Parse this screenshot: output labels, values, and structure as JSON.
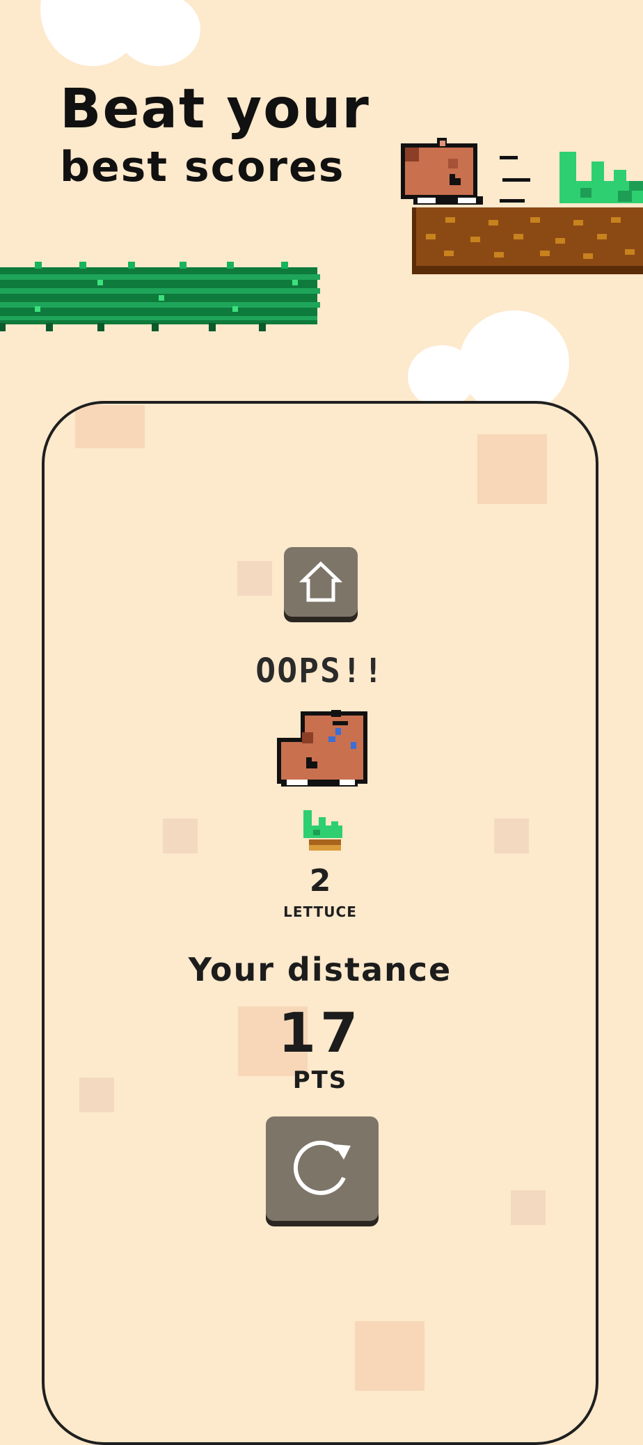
{
  "headline": {
    "line1": "Beat your",
    "line2": "best scores"
  },
  "result": {
    "title": "OOPS!!",
    "lettuce_count": "2",
    "lettuce_label": "LETTUCE",
    "distance_label": "Your distance",
    "distance_value": "17",
    "distance_unit": "PTS"
  },
  "icons": {
    "home": "home-icon",
    "replay": "replay-icon",
    "capybara": "capybara-sprite",
    "lettuce": "lettuce-icon"
  },
  "colors": {
    "background": "#fde9cc",
    "button": "#7d7568",
    "dirt": "#8b4a14",
    "grass": "#1f9e5a",
    "capybara": "#c9704f"
  }
}
